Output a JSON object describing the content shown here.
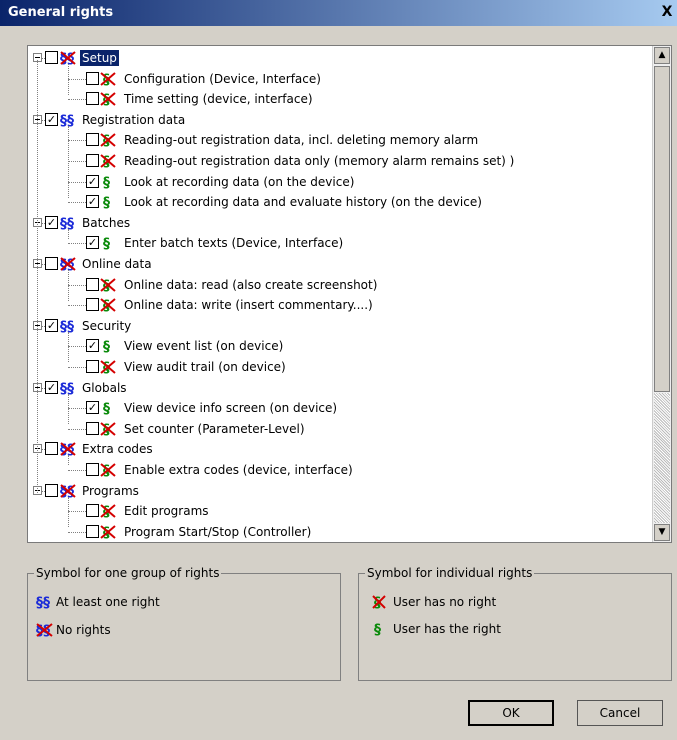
{
  "window": {
    "title": "General rights",
    "close_label": "X"
  },
  "tree": {
    "groups": [
      {
        "label": "Setup",
        "checked": false,
        "status": "none",
        "selected": true,
        "items": [
          {
            "label": "Configuration (Device, Interface)",
            "checked": false,
            "status": "none"
          },
          {
            "label": "Time setting (device, interface)",
            "checked": false,
            "status": "none"
          }
        ]
      },
      {
        "label": "Registration data",
        "checked": true,
        "status": "some",
        "items": [
          {
            "label": "Reading-out registration data, incl. deleting memory alarm",
            "checked": false,
            "status": "none"
          },
          {
            "label": "Reading-out registration data only (memory alarm remains set) )",
            "checked": false,
            "status": "none"
          },
          {
            "label": "Look at recording data (on the device)",
            "checked": true,
            "status": "has"
          },
          {
            "label": "Look at recording data and evaluate history (on the device)",
            "checked": true,
            "status": "has"
          }
        ]
      },
      {
        "label": "Batches",
        "checked": true,
        "status": "some",
        "items": [
          {
            "label": "Enter batch texts (Device, Interface)",
            "checked": true,
            "status": "has"
          }
        ]
      },
      {
        "label": "Online data",
        "checked": false,
        "status": "none",
        "items": [
          {
            "label": "Online data: read (also create screenshot)",
            "checked": false,
            "status": "none"
          },
          {
            "label": "Online data: write (insert commentary....)",
            "checked": false,
            "status": "none"
          }
        ]
      },
      {
        "label": "Security",
        "checked": true,
        "status": "some",
        "items": [
          {
            "label": "View event list (on device)",
            "checked": true,
            "status": "has"
          },
          {
            "label": "View audit trail (on device)",
            "checked": false,
            "status": "none"
          }
        ]
      },
      {
        "label": "Globals",
        "checked": true,
        "status": "some",
        "items": [
          {
            "label": "View device info screen (on device)",
            "checked": true,
            "status": "has"
          },
          {
            "label": "Set counter (Parameter-Level)",
            "checked": false,
            "status": "none"
          }
        ]
      },
      {
        "label": "Extra codes",
        "checked": false,
        "status": "none",
        "items": [
          {
            "label": "Enable extra codes (device, interface)",
            "checked": false,
            "status": "none"
          }
        ]
      },
      {
        "label": "Programs",
        "checked": false,
        "status": "none",
        "items": [
          {
            "label": "Edit programs",
            "checked": false,
            "status": "none"
          },
          {
            "label": "Program Start/Stop (Controller)",
            "checked": false,
            "status": "none"
          }
        ]
      }
    ]
  },
  "legend_group": {
    "title": "Symbol for one group of rights",
    "at_least_one": "At least one right",
    "no_rights": "No rights"
  },
  "legend_individual": {
    "title": "Symbol for individual rights",
    "no_right": "User has no right",
    "has_right": "User has the right"
  },
  "buttons": {
    "ok": "OK",
    "cancel": "Cancel"
  },
  "icons": {
    "group_some": "double-section-blue-icon",
    "group_none": "double-section-crossed-icon",
    "item_has": "section-green-icon",
    "item_none": "section-crossed-icon"
  },
  "colors": {
    "blue": "#1b2bd8",
    "green": "#0a8a0a",
    "red": "#d40000",
    "selection": "#0a246a"
  }
}
